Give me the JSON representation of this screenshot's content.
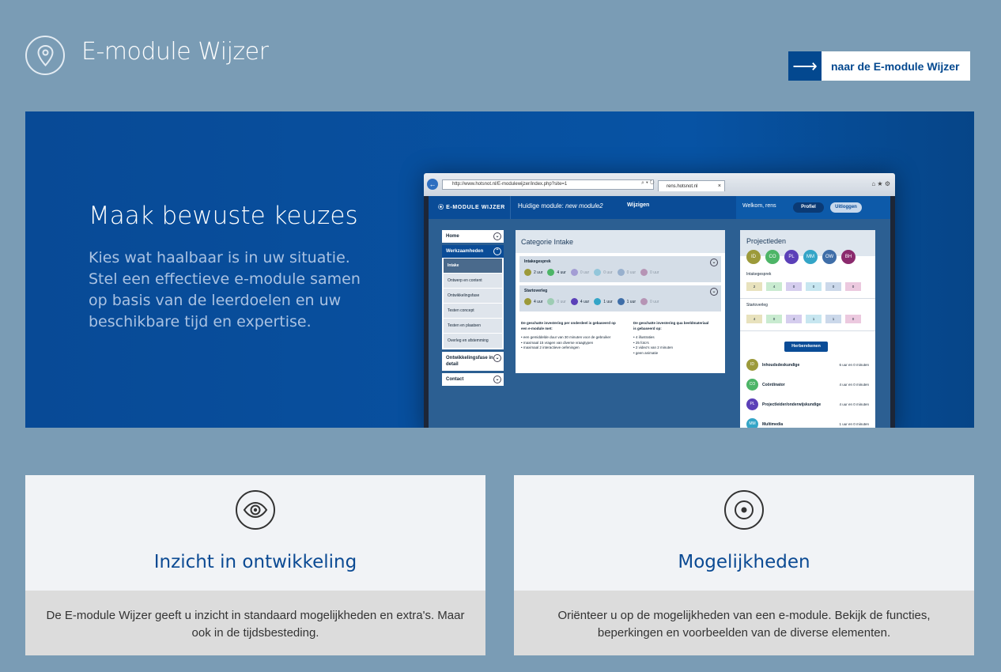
{
  "header": {
    "title": "E-module Wijzer",
    "logo_icon": "location-pin-icon",
    "cta_label": "naar de E-module Wijzer",
    "cta_icon": "arrow-right-icon"
  },
  "hero": {
    "title": "Maak bewuste keuzes",
    "text": "Kies wat haalbaar is in uw situatie. Stel een effectieve e-module samen op basis van de leerdoelen en uw beschikbare tijd en expertise."
  },
  "browser": {
    "address": "http://www.hotsnot.nl/E-modulewijzer/index.php?site=1",
    "tab_title": "rens.hotsnot.nl",
    "nav": {
      "brand": "E-MODULE WIJZER",
      "current_prefix": "Huidige module: ",
      "current_module": "new module2",
      "change": "Wijzigen",
      "welcome": "Welkom, rens",
      "profile": "Profiel",
      "logout": "Uitloggen"
    },
    "sidebar": {
      "home": "Home",
      "werkzaamheden": "Werkzaamheden",
      "sub": [
        "Intake",
        "Ontwerp en content",
        "Ontwikkelingsfase",
        "Testen concept",
        "Testen en plaatsen",
        "Overleg en afstemming"
      ],
      "detail": "Ontwikkelingsfase in detail",
      "contact": "Contact"
    },
    "category": {
      "title": "Categorie Intake",
      "sections": [
        {
          "name": "Intakegesprek",
          "items": [
            {
              "code": "ID",
              "value": "2 uur"
            },
            {
              "code": "CO",
              "value": "4 uur"
            },
            {
              "code": "PL",
              "value": "0 uur"
            },
            {
              "code": "MM",
              "value": "0 uur"
            },
            {
              "code": "OW",
              "value": "0 uur"
            },
            {
              "code": "BH",
              "value": "0 uur"
            }
          ]
        },
        {
          "name": "Startoverleg",
          "items": [
            {
              "code": "ID",
              "value": "4 uur"
            },
            {
              "code": "CO",
              "value": "0 uur"
            },
            {
              "code": "PL",
              "value": "4 uur"
            },
            {
              "code": "MM",
              "value": "1 uur"
            },
            {
              "code": "OW",
              "value": "1 uur"
            },
            {
              "code": "BH",
              "value": "0 uur"
            }
          ]
        }
      ],
      "note_left_title": "De geschatte investering per onderdeel is gebaseerd op een e-module met:",
      "note_left_items": [
        "een gemiddelde duur van 30 minuten voor de gebruiker",
        "maximaal 15 vragen van diverse vraagtypen",
        "maximaal 2 interactieve oefeningen"
      ],
      "note_right_title": "De geschatte investering qua beeldmateriaal is gebaseerd op:",
      "note_right_items": [
        "4 illustraties",
        "25 foto's",
        "2 video's van 2 minuten",
        "geen animatie"
      ]
    },
    "project": {
      "title": "Projectleden",
      "members": [
        "ID",
        "CO",
        "PL",
        "MM",
        "OW",
        "BH"
      ],
      "intake_label": "Intakegesprek",
      "intake_values": [
        "2",
        "4",
        "0",
        "0",
        "0",
        "0"
      ],
      "start_label": "Startoverleg",
      "start_values": [
        "4",
        "0",
        "4",
        "1",
        "1",
        "0"
      ],
      "recalc": "Herberekenen",
      "summary": [
        {
          "code": "ID",
          "name": "Inhoudsdeskundige",
          "time": "6 uur en 0 minuten"
        },
        {
          "code": "CO",
          "name": "Coördinator",
          "time": "4 uur en 0 minuten"
        },
        {
          "code": "PL",
          "name": "Projectleider/onderwijskundige",
          "time": "4 uur en 0 minuten"
        },
        {
          "code": "MM",
          "name": "Multimedia",
          "time": "1 uur en 0 minuten"
        }
      ]
    }
  },
  "colors": {
    "ID": "#9c9a3a",
    "CO": "#4db567",
    "PL": "#5b40b8",
    "MM": "#34a5c7",
    "OW": "#3f6ea8",
    "BH": "#8b2a6d"
  },
  "cards": [
    {
      "icon": "eye-icon",
      "title": "Inzicht in ontwikkeling",
      "text": "De E-module Wijzer geeft u inzicht in standaard mogelijkheden en extra's. Maar ook in de tijdsbesteding."
    },
    {
      "icon": "target-icon",
      "title": "Mogelijkheden",
      "text": "Oriënteer u op de mogelijkheden van een e-module. Bekijk de functies, beperkingen en voorbeelden van de diverse elementen."
    }
  ]
}
